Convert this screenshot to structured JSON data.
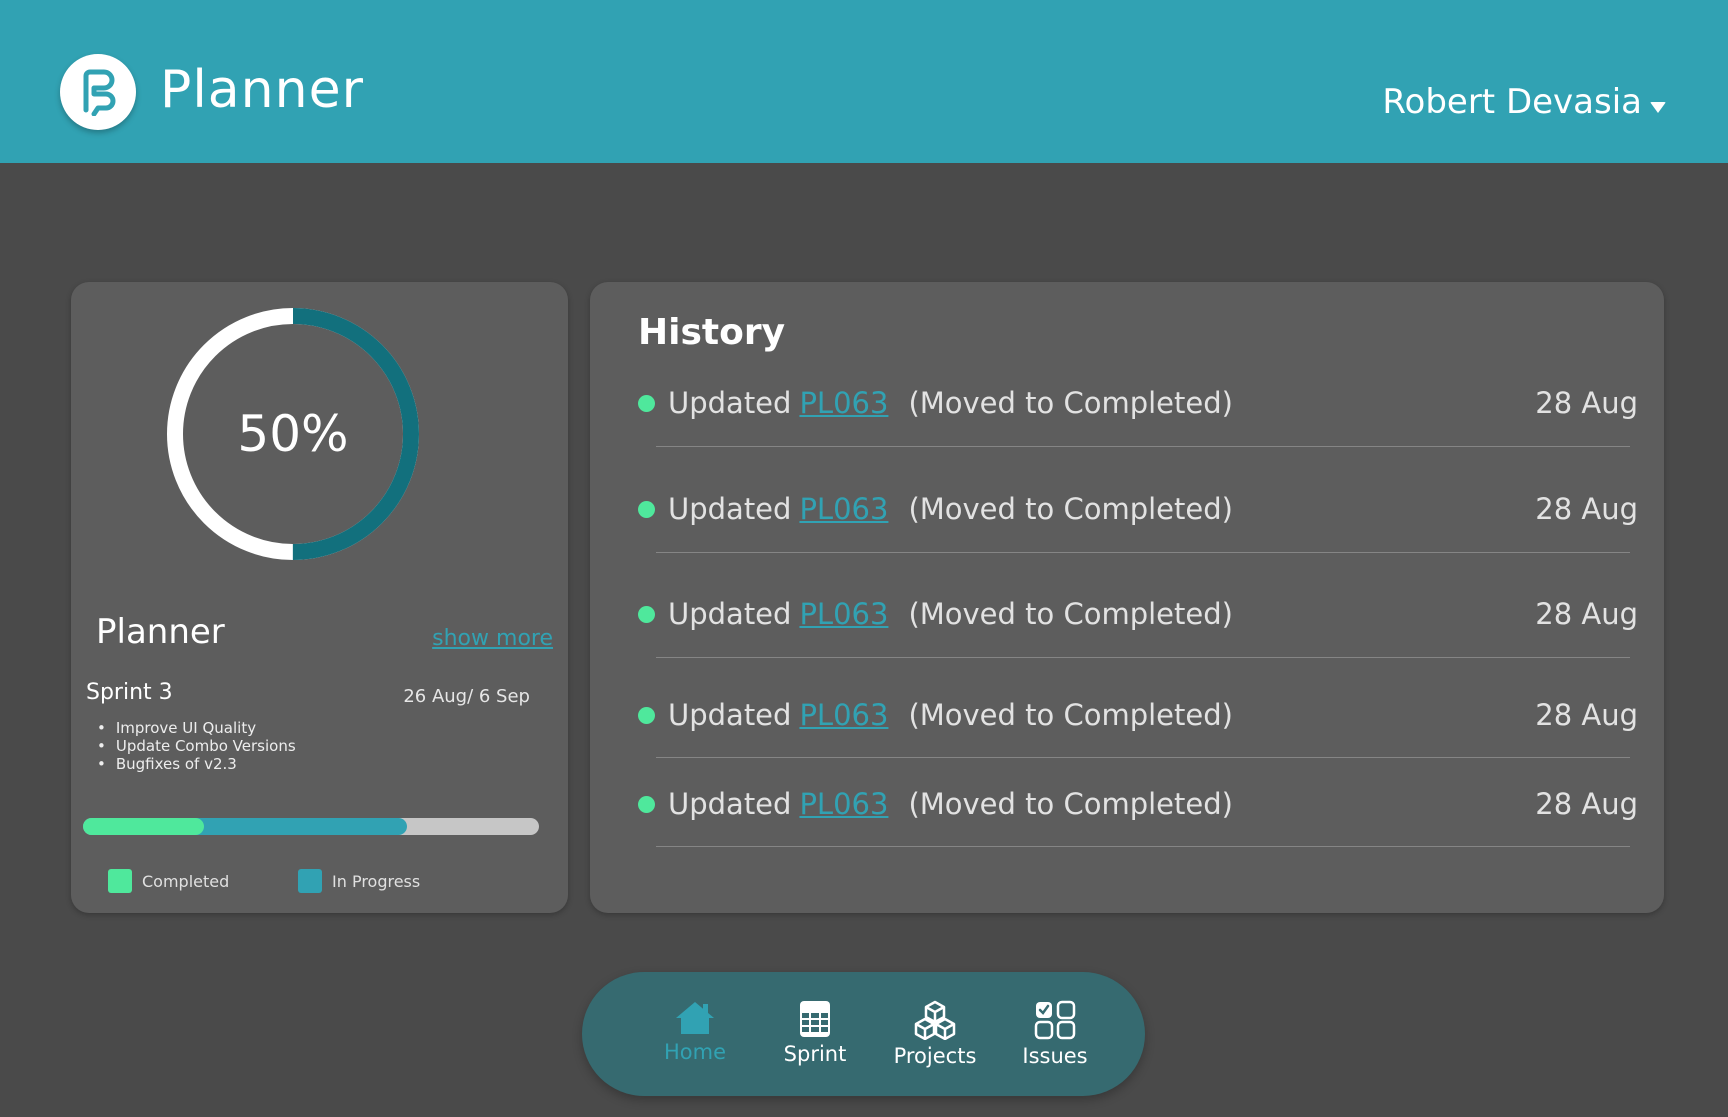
{
  "header": {
    "app_title": "Planner",
    "user_name": "Robert Devasia",
    "bg_color": "#31a2b3"
  },
  "project_card": {
    "progress_percent": 50,
    "progress_label": "50%",
    "project_name": "Planner",
    "show_more": "show more",
    "sprint_name": "Sprint  3",
    "sprint_dates": "26 Aug/ 6 Sep",
    "tasks": [
      "Improve UI Quality",
      "Update Combo Versions",
      "Bugfixes of v2.3"
    ],
    "bar": {
      "completed_fraction": 0.265,
      "in_progress_fraction": 0.71
    },
    "legend": {
      "completed": "Completed",
      "in_progress": "In Progress"
    },
    "colors": {
      "completed": "#4fe89c",
      "in_progress": "#31a2b3",
      "ring": "#12707d",
      "remaining": "#c6c6c6"
    }
  },
  "history": {
    "title": "History",
    "items": [
      {
        "action": "Updated",
        "link": "PL063",
        "detail": "(Moved to Completed)",
        "date": "28 Aug"
      },
      {
        "action": "Updated",
        "link": "PL063",
        "detail": "(Moved to Completed)",
        "date": "28 Aug"
      },
      {
        "action": "Updated",
        "link": "PL063",
        "detail": "(Moved to Completed)",
        "date": "28 Aug"
      },
      {
        "action": "Updated",
        "link": "PL063",
        "detail": "(Moved to Completed)",
        "date": "28 Aug"
      },
      {
        "action": "Updated",
        "link": "PL063",
        "detail": "(Moved to Completed)",
        "date": "28 Aug"
      }
    ]
  },
  "nav": {
    "items": [
      {
        "label": "Home",
        "icon": "home-icon",
        "active": true
      },
      {
        "label": "Sprint",
        "icon": "calendar-grid-icon",
        "active": false
      },
      {
        "label": "Projects",
        "icon": "cubes-icon",
        "active": false
      },
      {
        "label": "Issues",
        "icon": "checklist-grid-icon",
        "active": false
      }
    ]
  }
}
